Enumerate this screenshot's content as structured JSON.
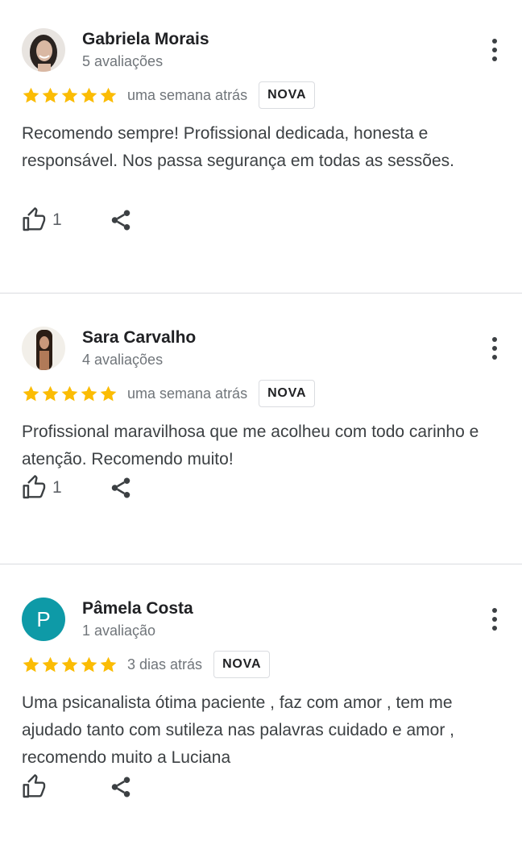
{
  "reviews": [
    {
      "author": "Gabriela Morais",
      "review_count": "5 avaliações",
      "rating": 5,
      "date": "uma semana atrás",
      "badge": "NOVA",
      "text": "Recomendo sempre! Profissional dedicada, honesta e responsável. Nos passa segurança em todas as sessões.",
      "likes": "1",
      "avatar": "photo"
    },
    {
      "author": "Sara Carvalho",
      "review_count": "4 avaliações",
      "rating": 5,
      "date": "uma semana atrás",
      "badge": "NOVA",
      "text": "Profissional maravilhosa que me acolheu com todo carinho e atenção. Recomendo muito!",
      "likes": "1",
      "avatar": "photo"
    },
    {
      "author": "Pâmela Costa",
      "review_count": "1 avaliação",
      "rating": 5,
      "date": "3 dias atrás",
      "badge": "NOVA",
      "text": "Uma psicanalista ótima paciente , faz com amor , tem me ajudado tanto com sutileza nas palavras cuidado e amor , recomendo muito a Luciana",
      "likes": "",
      "avatar_letter": "P",
      "avatar_color": "#0e9aa7"
    }
  ],
  "colors": {
    "star": "#fbbc04",
    "divider": "#dadce0",
    "secondary_text": "#70757a"
  },
  "icons": {
    "like": "thumb-up-outline-icon",
    "share": "share-icon",
    "more": "more-vert-icon",
    "star": "star-icon"
  }
}
